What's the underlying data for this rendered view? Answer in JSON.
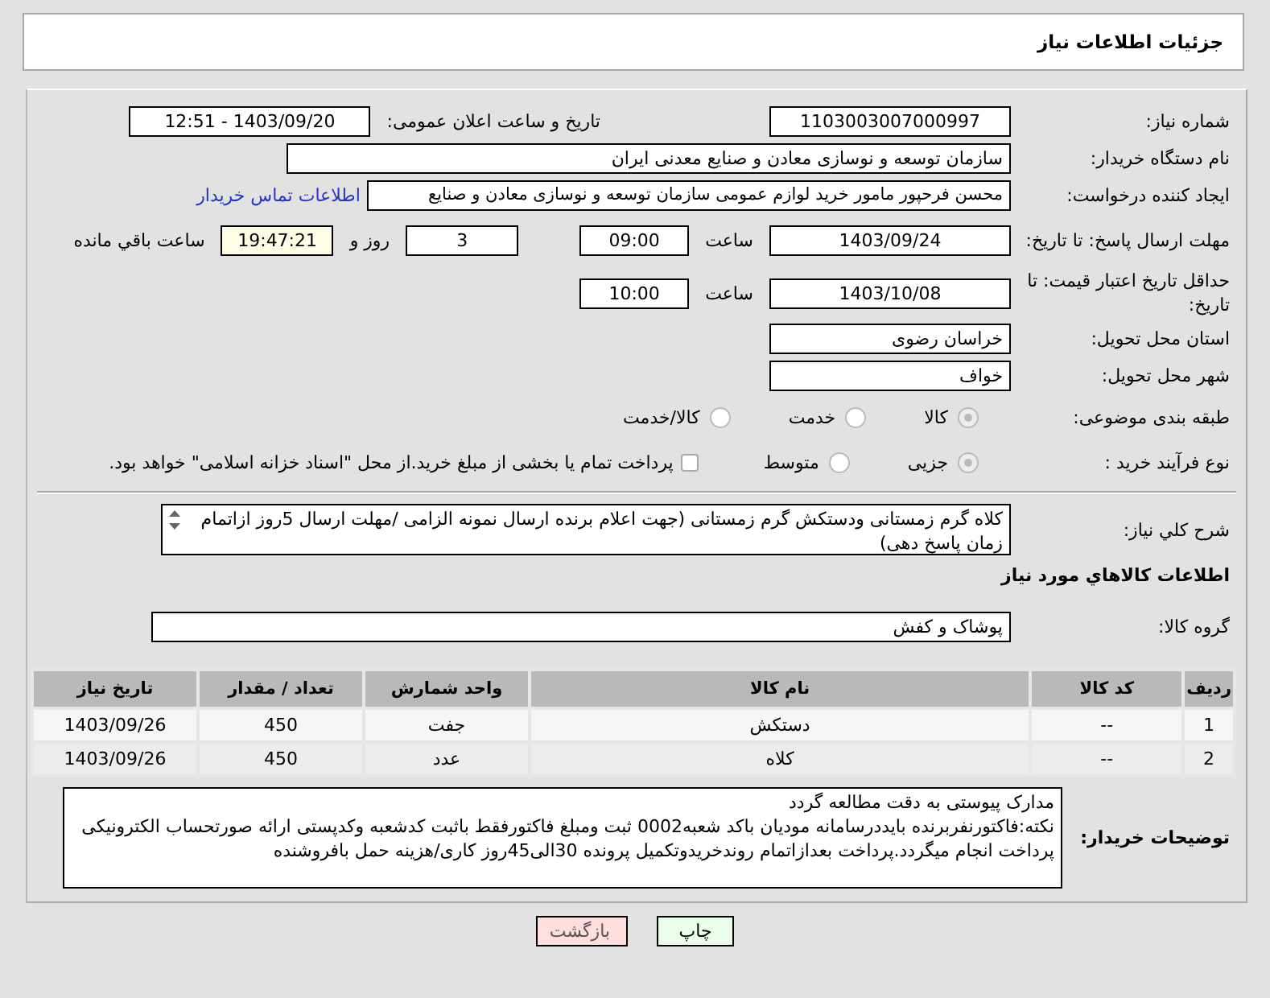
{
  "header": {
    "title": "جزئیات اطلاعات نیاز"
  },
  "need_number": {
    "label": "شماره نیاز:",
    "value": "1103003007000997"
  },
  "announce": {
    "label": "تاریخ و ساعت اعلان عمومی:",
    "value": "1403/09/20 - 12:51"
  },
  "buyer_org": {
    "label": "نام دستگاه خریدار:",
    "value": "سازمان توسعه و نوسازی معادن و صنایع معدنی ایران"
  },
  "requester": {
    "label": "ایجاد کننده درخواست:",
    "value": "محسن فرحپور مامور خرید لوازم عمومی سازمان توسعه و نوسازی معادن و صنایع",
    "link": "اطلاعات تماس خریدار"
  },
  "deadline": {
    "label": "مهلت ارسال پاسخ: تا تاریخ:",
    "date": "1403/09/24",
    "time_label": "ساعت",
    "time": "09:00",
    "days": "3",
    "days_label": "روز و",
    "remaining": "19:47:21",
    "remaining_label": "ساعت باقي مانده"
  },
  "price_validity": {
    "label": "حداقل تاریخ اعتبار قیمت: تا تاریخ:",
    "date": "1403/10/08",
    "time_label": "ساعت",
    "time": "10:00"
  },
  "province": {
    "label": "استان محل تحویل:",
    "value": "خراسان رضوی"
  },
  "city": {
    "label": "شهر محل تحویل:",
    "value": "خواف"
  },
  "category": {
    "label": "طبقه بندی موضوعی:",
    "options": [
      {
        "label": "کالا",
        "selected": true
      },
      {
        "label": "خدمت",
        "selected": false
      },
      {
        "label": "کالا/خدمت",
        "selected": false
      }
    ]
  },
  "process": {
    "label": "نوع فرآیند خرید :",
    "options": [
      {
        "label": "جزیی",
        "selected": true
      },
      {
        "label": "متوسط",
        "selected": false
      }
    ],
    "treasury": {
      "checked": false,
      "label": "پرداخت تمام یا بخشی از مبلغ خرید.از محل \"اسناد خزانه اسلامی\" خواهد بود."
    }
  },
  "description": {
    "label": "شرح کلي نیاز:",
    "value": "کلاه گرم زمستانی ودستکش گرم زمستانی (جهت اعلام برنده ارسال نمونه الزامی /مهلت ارسال 5روز ازاتمام زمان پاسخ دهی)"
  },
  "items_heading": "اطلاعات کالاهاي مورد نیاز",
  "group": {
    "label": "گروه کالا:",
    "value": "پوشاک و کفش"
  },
  "table": {
    "columns": [
      "ردیف",
      "کد کالا",
      "نام کالا",
      "واحد شمارش",
      "تعداد / مقدار",
      "تاریخ نیاز"
    ],
    "rows": [
      [
        "1",
        "--",
        "دستکش",
        "جفت",
        "450",
        "1403/09/26"
      ],
      [
        "2",
        "--",
        "کلاه",
        "عدد",
        "450",
        "1403/09/26"
      ]
    ]
  },
  "buyer_notes": {
    "label": "توضیحات خریدار:",
    "lines": [
      "مدارک پیوستی به دقت مطالعه گردد",
      "نکته:فاکتورنفربرنده بایددرسامانه مودیان باکد شعبه0002 ثبت ومبلغ فاکتورفقط باثبت کدشعبه وکدپستی ارائه صورتحساب الکترونیکی پرداخت انجام میگردد.پرداخت بعداز‌اتمام روندخریدوتکمیل پرونده 30الی45روز کاری/هزینه حمل بافروشنده"
    ]
  },
  "buttons": [
    {
      "label": "چاپ",
      "kind": "print"
    },
    {
      "label": "بازگشت",
      "kind": "back"
    }
  ]
}
